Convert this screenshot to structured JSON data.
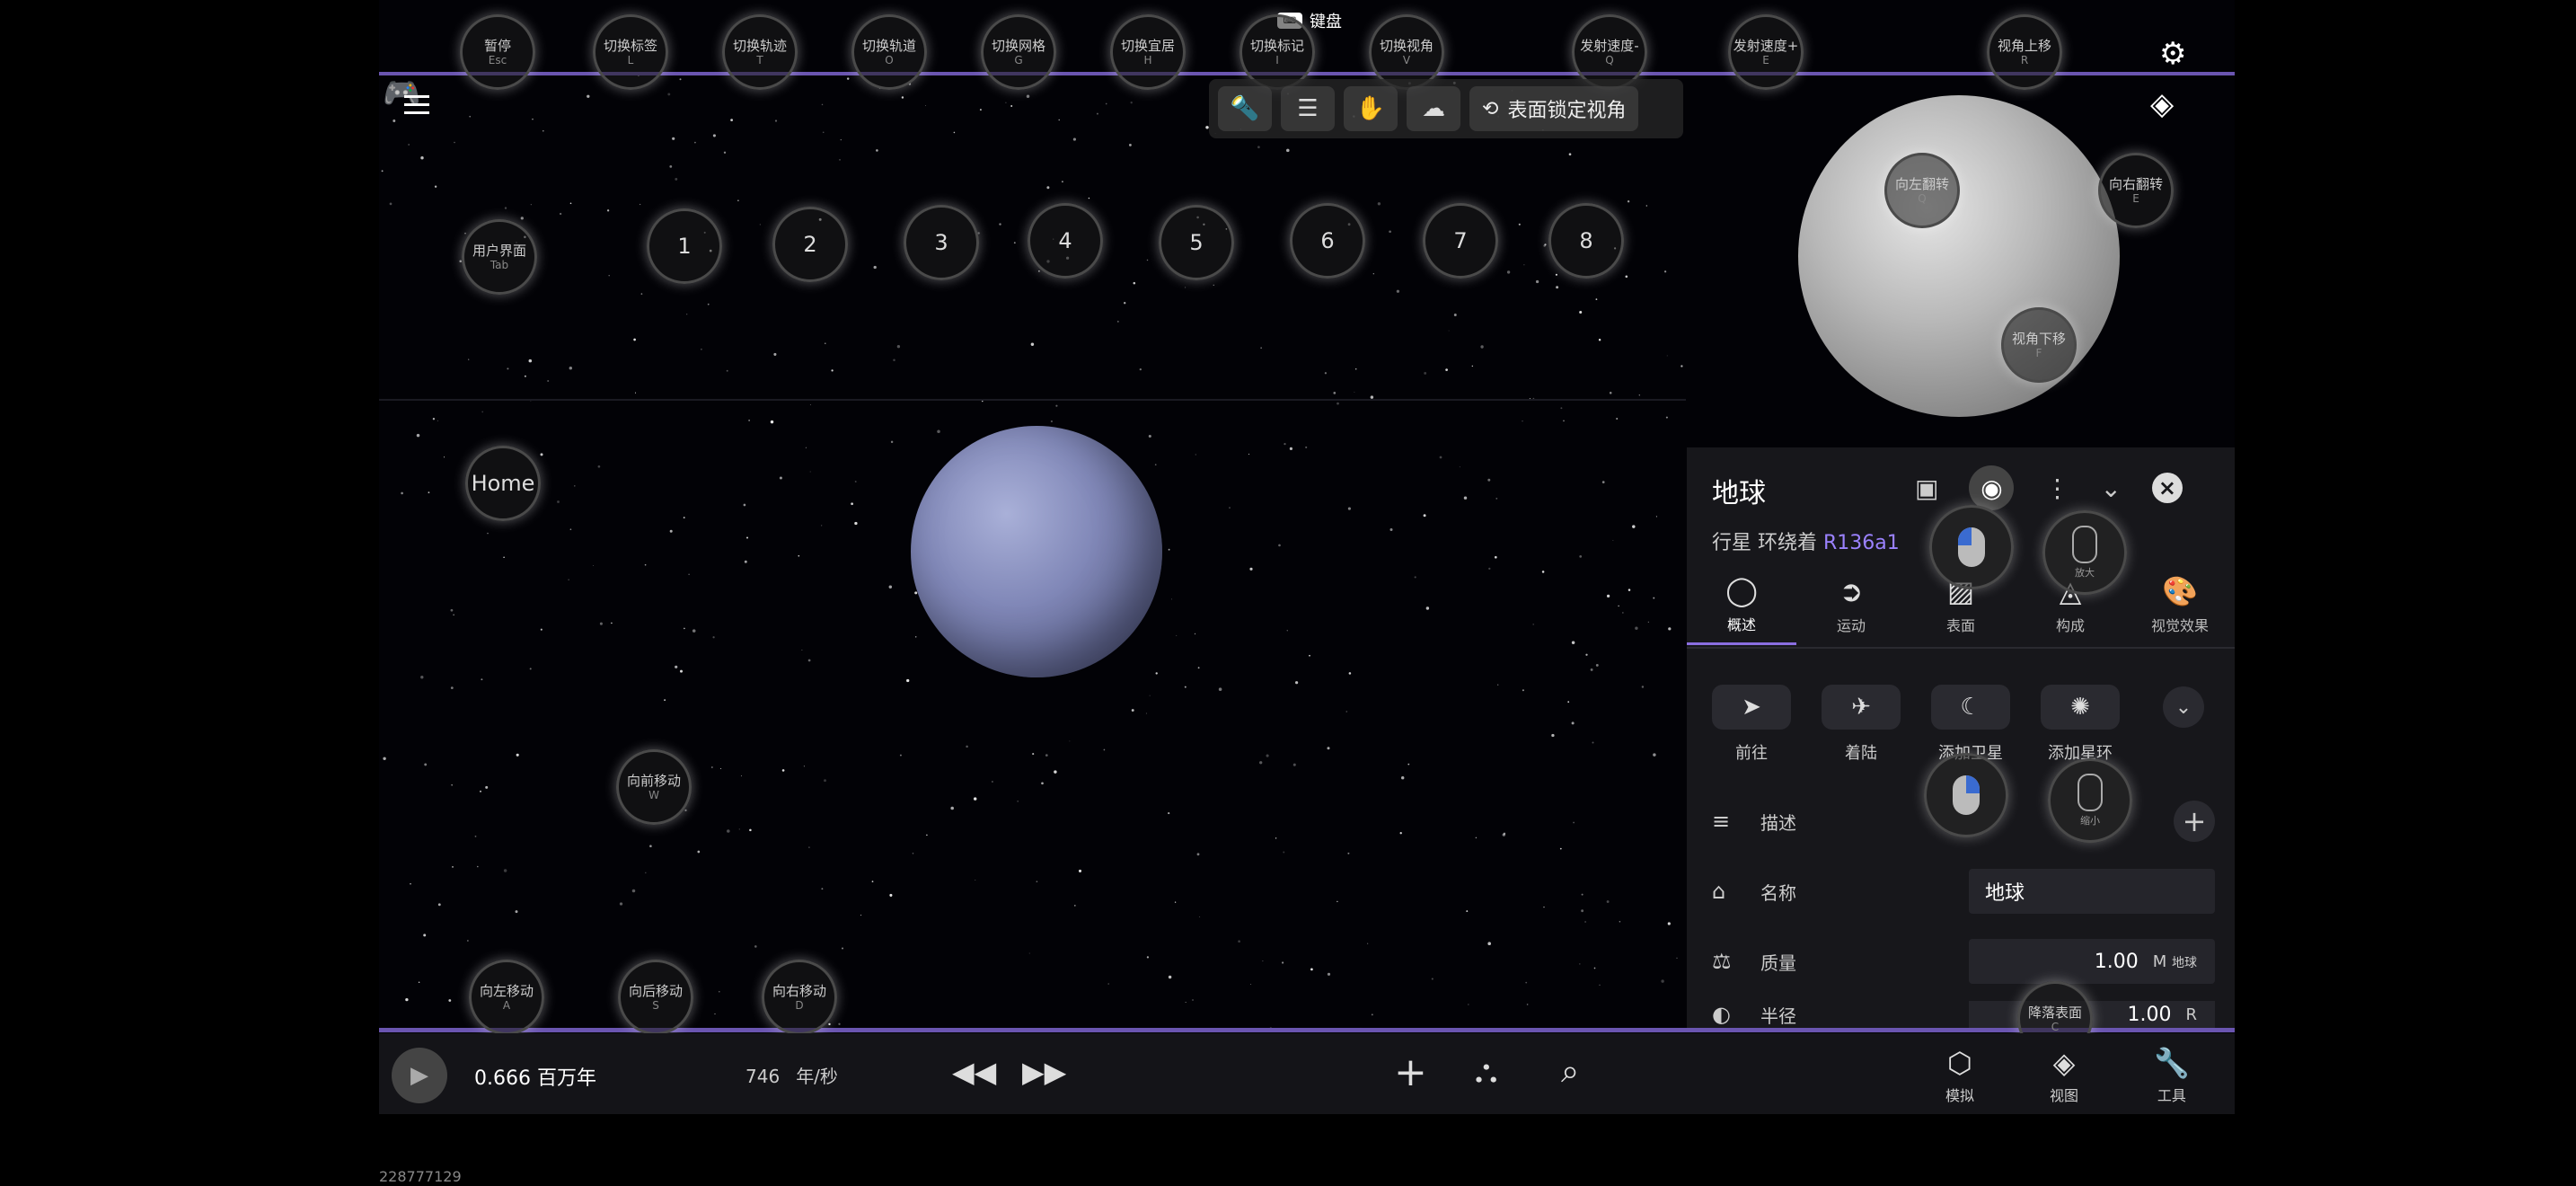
{
  "keyboard": {
    "label": "键盘"
  },
  "top_hints": [
    {
      "label": "暂停",
      "key": "Esc"
    },
    {
      "label": "切换标签",
      "key": "L"
    },
    {
      "label": "切换轨迹",
      "key": "T"
    },
    {
      "label": "切换轨道",
      "key": "O"
    },
    {
      "label": "切换网格",
      "key": "G"
    },
    {
      "label": "切换宜居",
      "key": "H"
    },
    {
      "label": "切换标记",
      "key": "I"
    },
    {
      "label": "切换视角",
      "key": "V"
    },
    {
      "label": "发射速度-",
      "key": "Q"
    },
    {
      "label": "发射速度+",
      "key": "E"
    },
    {
      "label": "视角上移",
      "key": "R"
    }
  ],
  "toolbar": {
    "lock_view_label": "表面锁定视角"
  },
  "user_ui_hint": {
    "label": "用户界面",
    "key": "Tab"
  },
  "number_hints": [
    "1",
    "2",
    "3",
    "4",
    "5",
    "6",
    "7",
    "8"
  ],
  "home_hint": {
    "label": "Home"
  },
  "move_hints": {
    "forward": {
      "label": "向前移动",
      "key": "W"
    },
    "left": {
      "label": "向左移动",
      "key": "A"
    },
    "back": {
      "label": "向后移动",
      "key": "S"
    },
    "right": {
      "label": "向右移动",
      "key": "D"
    }
  },
  "minimap_hints": {
    "roll_left": {
      "label": "向左翻转",
      "key": "Q"
    },
    "roll_right": {
      "label": "向右翻转",
      "key": "E"
    },
    "view_down": {
      "label": "视角下移",
      "key": "F"
    }
  },
  "panel": {
    "title": "地球",
    "subtitle_prefix": "行星 环绕着",
    "orbit_star": "R136a1",
    "tabs": [
      {
        "label": "概述",
        "icon": "circle-icon"
      },
      {
        "label": "运动",
        "icon": "motion-icon"
      },
      {
        "label": "表面",
        "icon": "surface-icon"
      },
      {
        "label": "构成",
        "icon": "composition-icon"
      },
      {
        "label": "视觉效果",
        "icon": "palette-icon"
      }
    ],
    "actions": [
      "前往",
      "着陆",
      "添加卫星",
      "添加星环"
    ],
    "rows": {
      "description": {
        "label": "描述"
      },
      "name": {
        "label": "名称",
        "value": "地球"
      },
      "mass": {
        "label": "质量",
        "value": "1.00",
        "unit": "M",
        "unit_sub": "地球"
      },
      "radius": {
        "label": "半径",
        "value": "1.00",
        "unit": "R"
      }
    },
    "mouse_hints": {
      "zoom_in": "放大",
      "zoom_out": "缩小",
      "drop_surface": {
        "label": "降落表面",
        "key": "C"
      }
    }
  },
  "bottom": {
    "time": "0.666 百万年",
    "speed_value": "746",
    "speed_unit": "年/秒",
    "tabs": [
      "模拟",
      "视图",
      "工具"
    ]
  },
  "footer_id": "228777129"
}
